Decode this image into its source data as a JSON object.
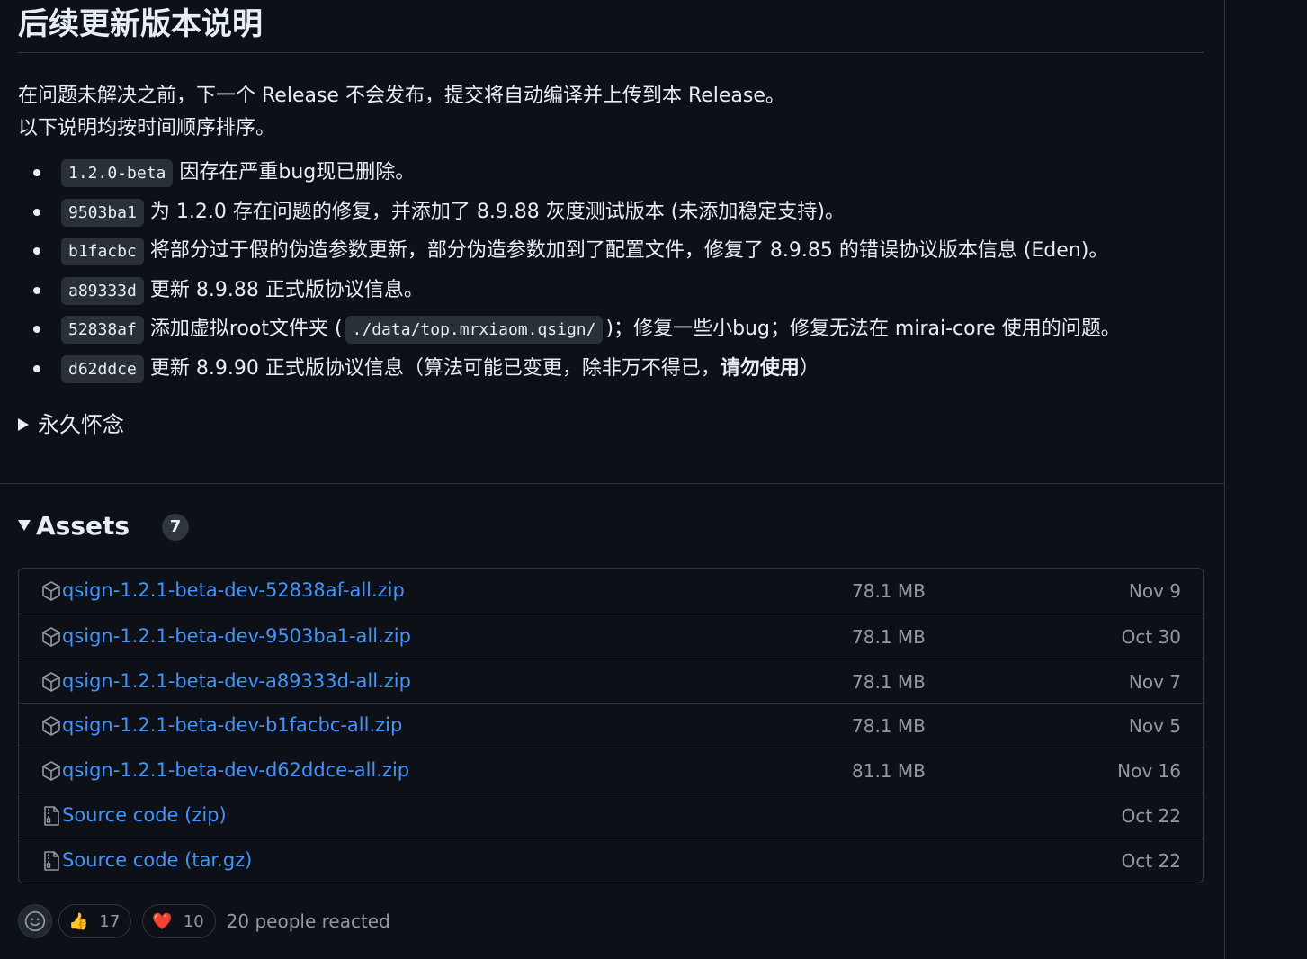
{
  "section_title": "后续更新版本说明",
  "intro": {
    "line1": "在问题未解决之前，下一个 Release 不会发布，提交将自动编译并上传到本 Release。",
    "line2": "以下说明均按时间顺序排序。"
  },
  "changes": [
    {
      "hash": "1.2.0-beta",
      "text": "因存在严重bug现已删除。"
    },
    {
      "hash": "9503ba1",
      "text": "为 1.2.0 存在问题的修复，并添加了 8.9.88 灰度测试版本 (未添加稳定支持)。"
    },
    {
      "hash": "b1facbc",
      "text": "将部分过于假的伪造参数更新，部分伪造参数加到了配置文件，修复了 8.9.85 的错误协议版本信息 (Eden)。"
    },
    {
      "hash": "a89333d",
      "text": "更新 8.9.88 正式版协议信息。"
    },
    {
      "hash": "52838af",
      "text_before": "添加虚拟root文件夹 (",
      "path": "./data/top.mrxiaom.qsign/",
      "text_after": ")；修复一些小bug；修复无法在 mirai-core 使用的问题。"
    },
    {
      "hash": "d62ddce",
      "text_before": "更新 8.9.90 正式版协议信息（算法可能已变更，除非万不得已，",
      "strong": "请勿使用",
      "text_after": "）"
    }
  ],
  "details_summary": "永久怀念",
  "assets": {
    "title": "Assets",
    "count": "7",
    "items": [
      {
        "name": "qsign-1.2.1-beta-dev-52838af-all.zip",
        "size": "78.1 MB",
        "date": "Nov 9",
        "icon": "package-icon"
      },
      {
        "name": "qsign-1.2.1-beta-dev-9503ba1-all.zip",
        "size": "78.1 MB",
        "date": "Oct 30",
        "icon": "package-icon"
      },
      {
        "name": "qsign-1.2.1-beta-dev-a89333d-all.zip",
        "size": "78.1 MB",
        "date": "Nov 7",
        "icon": "package-icon"
      },
      {
        "name": "qsign-1.2.1-beta-dev-b1facbc-all.zip",
        "size": "78.1 MB",
        "date": "Nov 5",
        "icon": "package-icon"
      },
      {
        "name": "qsign-1.2.1-beta-dev-d62ddce-all.zip",
        "size": "81.1 MB",
        "date": "Nov 16",
        "icon": "package-icon"
      },
      {
        "name": "Source code",
        "ext": "(zip)",
        "size": "",
        "date": "Oct 22",
        "icon": "file-zip-icon"
      },
      {
        "name": "Source code",
        "ext": "(tar.gz)",
        "size": "",
        "date": "Oct 22",
        "icon": "file-zip-icon"
      }
    ]
  },
  "reactions": {
    "thumbs_up_emoji": "👍",
    "thumbs_up_count": "17",
    "heart_emoji": "❤️",
    "heart_count": "10",
    "summary": "20 people reacted"
  },
  "colors": {
    "background": "#0d1117",
    "link": "#4493f8",
    "muted": "#9198a1",
    "border": "#30363d"
  }
}
